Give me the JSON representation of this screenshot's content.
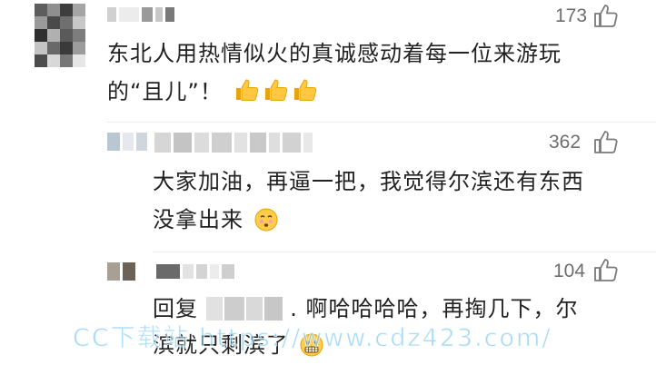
{
  "comments": [
    {
      "likes": "173",
      "text_line1": "东北人用热情似火的真诚感动着每一位来游玩",
      "text_line2": "的“且儿”！",
      "reactions": [
        "thumbs-up-emoji",
        "thumbs-up-emoji",
        "thumbs-up-emoji"
      ]
    },
    {
      "likes": "362",
      "text_line1": "大家加油，再逼一把，我觉得尔滨还有东西",
      "text_line2": "没拿出来",
      "reactions": [
        "hushed-face-emoji"
      ]
    },
    {
      "likes": "104",
      "reply_prefix": "回复",
      "text_line1_suffix": ". 啊哈哈哈哈，再掏几下，尔",
      "text_line2": "滨就只剩滨了",
      "reactions": [
        "grimacing-face-emoji"
      ]
    }
  ],
  "watermark": "CC下载站 https://www.cdz423.com/",
  "colors": {
    "text": "#222222",
    "count": "#6e6e6e",
    "icon": "#7a7a7a",
    "watermark": "#5ab9f0"
  }
}
